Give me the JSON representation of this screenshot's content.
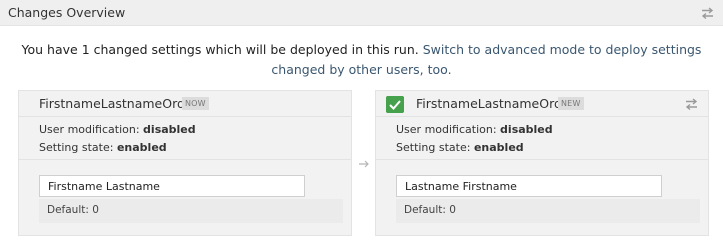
{
  "header": {
    "title": "Changes Overview",
    "toggle_icon": "swap-arrows-icon"
  },
  "intro": {
    "text": "You have 1 changed settings which will be deployed in this run.",
    "link_text": "Switch to advanced mode to deploy settings changed by other users, too."
  },
  "current": {
    "name": "FirstnameLastnameOrder",
    "badge": "NOW",
    "user_mod_label": "User modification:",
    "user_mod_value": "disabled",
    "state_label": "Setting state:",
    "state_value": "enabled",
    "value": "Firstname Lastname",
    "default": "Default: 0"
  },
  "new": {
    "name": "FirstnameLastnameOrder",
    "badge": "NEW",
    "checked": true,
    "user_mod_label": "User modification:",
    "user_mod_value": "disabled",
    "state_label": "Setting state:",
    "state_value": "enabled",
    "value": "Lastname Firstname",
    "default": "Default: 0"
  },
  "colors": {
    "header_bg": "#efefef",
    "panel_bg": "#f2f2f2",
    "link": "#3a5770",
    "checkbox": "#45a14b"
  }
}
